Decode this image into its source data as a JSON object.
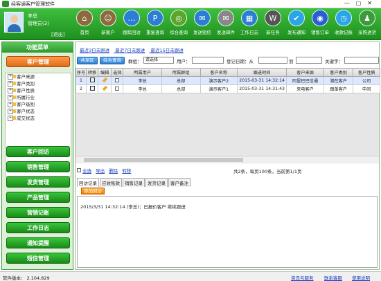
{
  "window": {
    "title": "经客通客户管理软件"
  },
  "user": {
    "name": "李总",
    "role": "管理员(3)",
    "logout": "[退出]"
  },
  "toolbar": [
    {
      "label": "首页",
      "icon": "home-icon",
      "color": "#8b6a3e",
      "glyph": "⌂"
    },
    {
      "label": "新客户",
      "icon": "new-customer-icon",
      "color": "#8b6a3e",
      "glyph": "☺"
    },
    {
      "label": "跟踪回访",
      "icon": "followup-icon",
      "color": "#2a7fd4",
      "glyph": "…"
    },
    {
      "label": "重复查询",
      "icon": "duplicate-query-icon",
      "color": "#2a7fd4",
      "glyph": "P"
    },
    {
      "label": "综合查询",
      "icon": "combined-query-icon",
      "color": "#5aa52a",
      "glyph": "◎"
    },
    {
      "label": "发送短信",
      "icon": "send-sms-icon",
      "color": "#2a7fd4",
      "glyph": "✉"
    },
    {
      "label": "发送邮件",
      "icon": "send-email-icon",
      "color": "#888888",
      "glyph": "✉"
    },
    {
      "label": "工作日志",
      "icon": "worklog-icon",
      "color": "#2a7fd4",
      "glyph": "▦"
    },
    {
      "label": "新任务",
      "icon": "new-task-icon",
      "color": "#555555",
      "glyph": "W"
    },
    {
      "label": "发布通知",
      "icon": "notify-icon",
      "color": "#2aa5e8",
      "glyph": "✔"
    },
    {
      "label": "销售订单",
      "icon": "sales-order-icon",
      "color": "#2a5fd4",
      "glyph": "◉"
    },
    {
      "label": "收款记账",
      "icon": "payment-icon",
      "color": "#2aa5e8",
      "glyph": "◷"
    },
    {
      "label": "采购进货",
      "icon": "purchase-icon",
      "color": "#3e9a3e",
      "glyph": "♟"
    }
  ],
  "sidebar": {
    "title": "功能菜单",
    "active": "客户管理",
    "tree": [
      "客户来源",
      "客户类别",
      "客户性质",
      "所属行业",
      "客户级别",
      "客户状态",
      "成交状态"
    ],
    "menus": [
      "客户回访",
      "销售管理",
      "发货管理",
      "产品管理",
      "营销记账",
      "工作日志",
      "通知提醒",
      "短信管理"
    ]
  },
  "main": {
    "links": [
      "最近3日未跟进",
      "最近7日未跟进",
      "最近15日未跟进"
    ],
    "buttons": {
      "shared": "共享区",
      "combined": "综合查询"
    },
    "filter": {
      "group_label": "群组：",
      "group_value": "请选择",
      "user_label": "用户：",
      "date_label": "登记日期：从",
      "to_label": "到",
      "keyword_label": "关键字："
    },
    "columns": [
      "序号",
      "转移",
      "编辑",
      "选择",
      "所属用户",
      "所属群组",
      "客户名称",
      "跟进时间",
      "客户来源",
      "客户类别",
      "客户性质"
    ],
    "rows": [
      {
        "no": "1",
        "user": "李总",
        "group": "总部",
        "name": "演示客户2",
        "time": "2015-03-31 14:32:14",
        "source": "阿里巴巴信通",
        "category": "潜在客户",
        "nature": "公司"
      },
      {
        "no": "2",
        "user": "李总",
        "group": "总部",
        "name": "演示客户1",
        "time": "2015-03-31 14:31:43",
        "source": "来电客户",
        "category": "跟单客户",
        "nature": "中间"
      }
    ],
    "actions": [
      "全选",
      "导出",
      "删除",
      "转移"
    ],
    "page_info": "共2条，每页100条，当前第1/1页",
    "tabs": [
      "回访记录",
      "应收账款",
      "销售记录",
      "发货记录",
      "客户备注"
    ],
    "add_button": "添加回访",
    "log_entry": "2015/3/31 14:32:14 (李总)：已报价客户 继续跟进"
  },
  "status": {
    "version": "软件版本： 2.104.829",
    "links": [
      "资讯与服务",
      "联系客服",
      "使用说明"
    ]
  }
}
